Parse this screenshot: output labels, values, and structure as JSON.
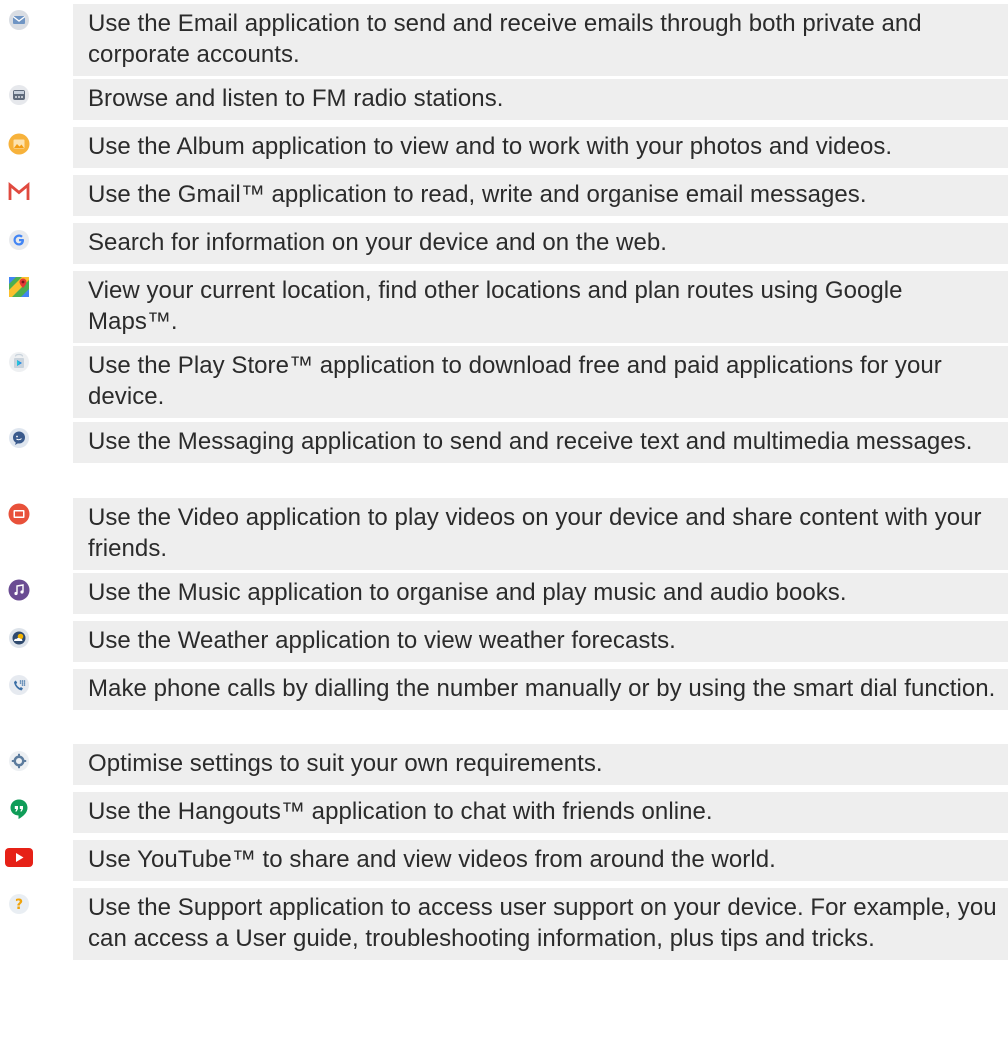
{
  "apps": [
    {
      "icon": "email-icon",
      "text": "Use the Email application to send and receive emails through both private and corporate accounts."
    },
    {
      "icon": "fm-radio-icon",
      "text": "Browse and listen to FM radio stations."
    },
    {
      "icon": "album-icon",
      "text": "Use the Album application to view and to work with your photos and videos."
    },
    {
      "icon": "gmail-icon",
      "text": "Use the Gmail™ application to read, write and organise email messages."
    },
    {
      "icon": "google-icon",
      "text": "Search for information on your device and on the web."
    },
    {
      "icon": "maps-icon",
      "text": "View your current location, find other locations and plan routes using Google Maps™."
    },
    {
      "icon": "play-store-icon",
      "text": "Use the Play Store™ application to download free and paid applications for your device."
    },
    {
      "icon": "messaging-icon",
      "text": "Use the Messaging application to send and receive text and multimedia messages."
    },
    {
      "icon": "video-icon",
      "text": "Use the Video application to play videos on your device and share content with your friends."
    },
    {
      "icon": "music-icon",
      "text": "Use the Music application to organise and play music and audio books."
    },
    {
      "icon": "weather-icon",
      "text": "Use the Weather application to view weather forecasts."
    },
    {
      "icon": "phone-icon",
      "text": "Make phone calls by dialling the number manually or by using the smart dial function."
    },
    {
      "icon": "settings-icon",
      "text": "Optimise settings to suit your own requirements."
    },
    {
      "icon": "hangouts-icon",
      "text": "Use the Hangouts™ application to chat with friends online."
    },
    {
      "icon": "youtube-icon",
      "text": "Use YouTube™ to share and view videos from around the world."
    },
    {
      "icon": "support-icon",
      "text": "Use the Support application to access user support on your device. For example, you can access a User guide, troubleshooting information, plus tips and tricks."
    }
  ],
  "colors": {
    "row_background": "#eeeeee",
    "text": "#2b2b2b"
  }
}
